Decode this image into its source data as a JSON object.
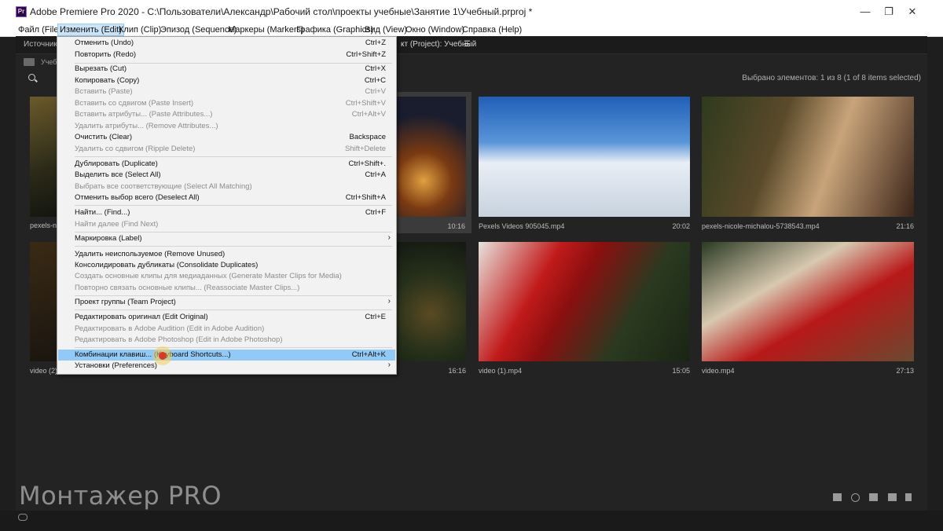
{
  "window": {
    "title": "Adobe Premiere Pro 2020 - C:\\Пользователи\\Александр\\Рабочий стол\\проекты учебные\\Занятие 1\\Учебный.prproj *",
    "icon_label": "Pr",
    "controls": [
      "minimize-icon",
      "restore-icon",
      "close-icon"
    ]
  },
  "menubar": {
    "items": [
      {
        "label": "Файл (File)"
      },
      {
        "label": "Изменить (Edit)"
      },
      {
        "label": "Клип (Clip)"
      },
      {
        "label": "Эпизод (Sequence)"
      },
      {
        "label": "Маркеры (Markers)"
      },
      {
        "label": "Графика (Graphics)"
      },
      {
        "label": "Вид (View)"
      },
      {
        "label": "Окно (Window)"
      },
      {
        "label": "Справка (Help)"
      }
    ]
  },
  "panel": {
    "source_tab": "Источник:",
    "project_tab": "кт (Project): Учебный",
    "project_partial": "Учебн",
    "selected_count": "Выбрано элементов: 1 из 8 (1 of 8 items selected)"
  },
  "clips": [
    {
      "name": "pexels-ni",
      "duration": ""
    },
    {
      "name": "",
      "duration": "10:16"
    },
    {
      "name": "Pexels Videos 905045.mp4",
      "duration": "20:02"
    },
    {
      "name": "pexels-nicole-michalou-5738543.mp4",
      "duration": "21:16"
    },
    {
      "name": "video (2)",
      "duration": ""
    },
    {
      "name": "",
      "duration": "16:16"
    },
    {
      "name": "video (1).mp4",
      "duration": "15:05"
    },
    {
      "name": "video.mp4",
      "duration": "27:13"
    }
  ],
  "edit_menu": {
    "items": [
      {
        "label": "Отменить (Undo)",
        "shortcut": "Ctrl+Z"
      },
      {
        "label": "Повторить (Redo)",
        "shortcut": "Ctrl+Shift+Z"
      },
      {
        "label": "Вырезать (Cut)",
        "shortcut": "Ctrl+X"
      },
      {
        "label": "Копировать (Copy)",
        "shortcut": "Ctrl+C"
      },
      {
        "label": "Вставить (Paste)",
        "shortcut": "Ctrl+V"
      },
      {
        "label": "Вставить со сдвигом (Paste Insert)",
        "shortcut": "Ctrl+Shift+V"
      },
      {
        "label": "Вставить атрибуты... (Paste Attributes...)",
        "shortcut": "Ctrl+Alt+V"
      },
      {
        "label": "Удалить атрибуты... (Remove Attributes...)",
        "shortcut": ""
      },
      {
        "label": "Очистить (Clear)",
        "shortcut": "Backspace"
      },
      {
        "label": "Удалить со сдвигом (Ripple Delete)",
        "shortcut": "Shift+Delete"
      },
      {
        "label": "Дублировать (Duplicate)",
        "shortcut": "Ctrl+Shift+."
      },
      {
        "label": "Выделить все (Select All)",
        "shortcut": "Ctrl+A"
      },
      {
        "label": "Выбрать все соответствующие (Select All Matching)",
        "shortcut": ""
      },
      {
        "label": "Отменить выбор всего (Deselect All)",
        "shortcut": "Ctrl+Shift+A"
      },
      {
        "label": "Найти... (Find...)",
        "shortcut": "Ctrl+F"
      },
      {
        "label": "Найти далее (Find Next)",
        "shortcut": ""
      },
      {
        "label": "Маркировка (Label)",
        "shortcut": ""
      },
      {
        "label": "Удалить неиспользуемое (Remove Unused)",
        "shortcut": ""
      },
      {
        "label": "Консолидировать дубликаты (Consolidate Duplicates)",
        "shortcut": ""
      },
      {
        "label": "Создать основные клипы для медиаданных (Generate Master Clips for Media)",
        "shortcut": ""
      },
      {
        "label": "Повторно связать основные клипы... (Reassociate Master Clips...)",
        "shortcut": ""
      },
      {
        "label": "Проект группы (Team Project)",
        "shortcut": ""
      },
      {
        "label": "Редактировать оригинал (Edit Original)",
        "shortcut": "Ctrl+E"
      },
      {
        "label": "Редактировать в Adobe Audition (Edit in Adobe Audition)",
        "shortcut": ""
      },
      {
        "label": "Редактировать в Adobe Photoshop (Edit in Adobe Photoshop)",
        "shortcut": ""
      },
      {
        "label": "Комбинации клавиш... (Keyboard Shortcuts...)",
        "shortcut": "Ctrl+Alt+K"
      },
      {
        "label": "Установки (Preferences)",
        "shortcut": ""
      }
    ]
  },
  "watermark": "Монтажер PRO",
  "colors": {
    "menu_highlight": "#91c9f7",
    "active_menubar": "#cce4f7",
    "panel_bg": "#232323"
  }
}
